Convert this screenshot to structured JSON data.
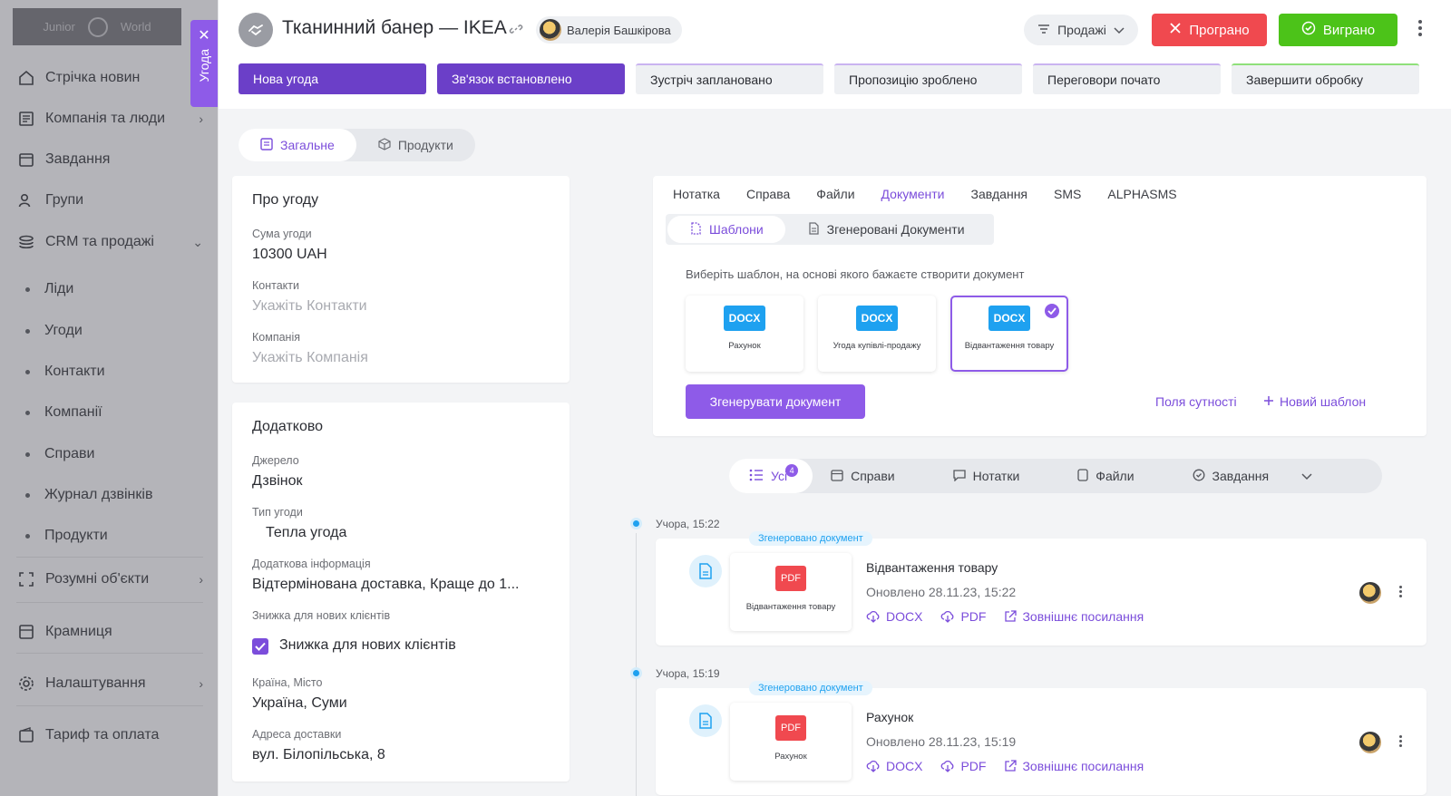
{
  "sidebar": {
    "logo": {
      "left": "Junior",
      "right": "World"
    },
    "items": [
      {
        "label": "Стрічка новин",
        "icon": "home-icon"
      },
      {
        "label": "Компанія та люди",
        "icon": "book-icon",
        "chevron": "›"
      },
      {
        "label": "Завдання",
        "icon": "calendar-icon"
      },
      {
        "label": "Групи",
        "icon": "users-icon"
      },
      {
        "label": "CRM та продажі",
        "icon": "coins-icon",
        "chevron": "⌄"
      }
    ],
    "subitems": [
      "Ліди",
      "Угоди",
      "Контакти",
      "Компанії",
      "Справи",
      "Журнал дзвінків",
      "Продукти"
    ],
    "items2": [
      {
        "label": "Розумні об'єкти",
        "icon": "scan-icon",
        "chevron": "›"
      },
      {
        "label": "Крамниця",
        "icon": "store-icon"
      },
      {
        "label": "Налаштування",
        "icon": "gear-icon",
        "chevron": "›"
      },
      {
        "label": "Тариф та оплата",
        "icon": "wallet-icon"
      }
    ]
  },
  "deal_tab": {
    "label": "Угода",
    "close": "✕"
  },
  "header": {
    "title": "Тканинний банер — IKEA",
    "owner": "Валерія Башкірова",
    "pipeline": "Продажі",
    "lost": "Програно",
    "won": "Виграно"
  },
  "stages": [
    {
      "label": "Нова угода",
      "state": "done"
    },
    {
      "label": "Зв'язок встановлено",
      "state": "done"
    },
    {
      "label": "Зустріч заплановано",
      "state": "todo"
    },
    {
      "label": "Пропозицію зроблено",
      "state": "todo"
    },
    {
      "label": "Переговори почато",
      "state": "todo"
    },
    {
      "label": "Завершити обробку",
      "state": "final"
    }
  ],
  "view_tabs": {
    "general": "Загальне",
    "products": "Продукти"
  },
  "about": {
    "title": "Про угоду",
    "amount_label": "Сума угоди",
    "amount_value": "10300 UAH",
    "contacts_label": "Контакти",
    "contacts_ph": "Укажіть Контакти",
    "company_label": "Компанія",
    "company_ph": "Укажіть Компанія"
  },
  "extra": {
    "title": "Додатково",
    "source_label": "Джерело",
    "source_value": "Дзвінок",
    "type_label": "Тип угоди",
    "type_value": "Тепла угода",
    "info_label": "Додаткова інформація",
    "info_value": "Відтермінована доставка, Краще до 1...",
    "discount_label": "Знижка для нових клієнтів",
    "discount_value": "Знижка для нових клієнтів",
    "city_label": "Країна, Місто",
    "city_value": "Україна, Суми",
    "address_label": "Адреса доставки",
    "address_value": "вул. Білопільська, 8"
  },
  "activity": {
    "tabs": [
      "Нотатка",
      "Справа",
      "Файли",
      "Документи",
      "Завдання",
      "SMS",
      "ALPHASMS"
    ],
    "active_tab": "Документи",
    "sub_templates": "Шаблони",
    "sub_generated": "Згенеровані Документи",
    "hint": "Виберіть шаблон, на основі якого бажаєте створити документ",
    "templates": [
      {
        "badge": "DOCX",
        "name": "Рахунок"
      },
      {
        "badge": "DOCX",
        "name": "Угода купівлі-продажу"
      },
      {
        "badge": "DOCX",
        "name": "Відвантаження товару"
      }
    ],
    "generate": "Згенерувати документ",
    "entity_fields": "Поля сутності",
    "new_template": "Новий шаблон"
  },
  "feed_filter": {
    "all": "Усі",
    "all_count": "4",
    "cases": "Справи",
    "notes": "Нотатки",
    "files": "Файли",
    "tasks": "Завдання"
  },
  "events": [
    {
      "time": "Учора, 15:22",
      "badge": "Згенеровано документ",
      "pdf": "PDF",
      "file": "Відвантаження товару",
      "title": "Відвантаження товару",
      "updated": "Оновлено 28.11.23, 15:22",
      "docx": "DOCX",
      "pdf_link": "PDF",
      "ext_link": "Зовнішнє посилання"
    },
    {
      "time": "Учора, 15:19",
      "badge": "Згенеровано документ",
      "pdf": "PDF",
      "file": "Рахунок",
      "title": "Рахунок",
      "updated": "Оновлено 28.11.23, 15:19",
      "docx": "DOCX",
      "pdf_link": "PDF",
      "ext_link": "Зовнішнє посилання"
    }
  ],
  "colors": {
    "accent": "#8e5be8",
    "accent_dark": "#6b3fc8",
    "lost": "#f0494f",
    "won": "#4cc319",
    "docx": "#1ea1f0",
    "pdf": "#f0494f"
  }
}
